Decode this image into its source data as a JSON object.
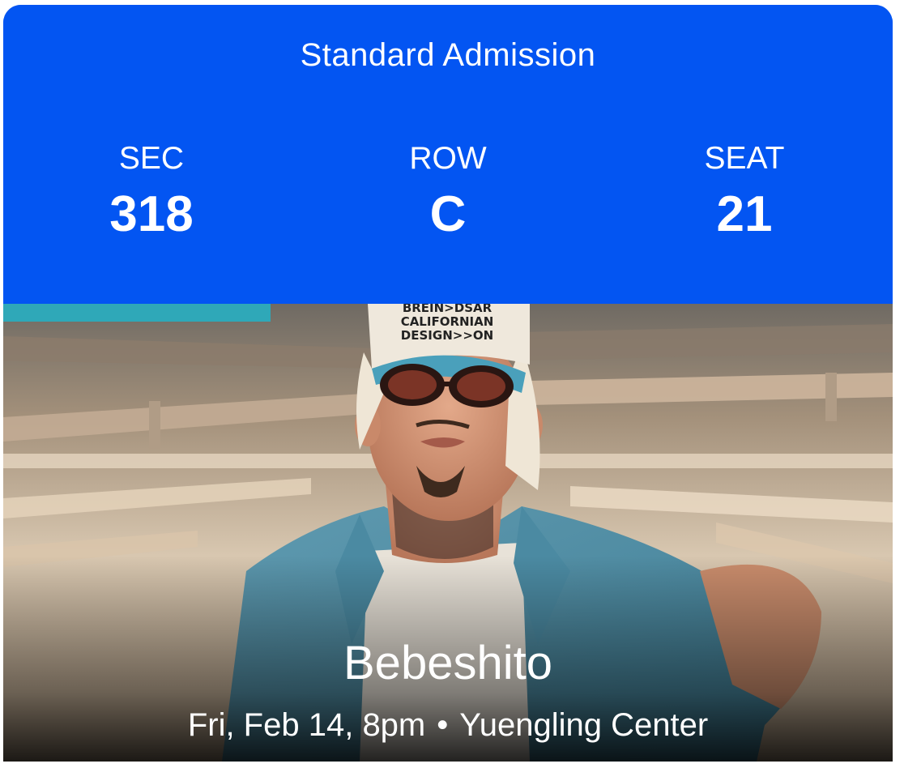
{
  "ticket": {
    "admission_type": "Standard Admission",
    "section": {
      "label": "SEC",
      "value": "318"
    },
    "row": {
      "label": "ROW",
      "value": "C"
    },
    "seat": {
      "label": "SEAT",
      "value": "21"
    }
  },
  "event": {
    "artist": "Bebeshito",
    "date_time": "Fri, Feb 14, 8pm",
    "separator": "•",
    "venue": "Yuengling Center",
    "cap_text": [
      "BREIN>DSAR",
      "CALIFORNIAN",
      "DESIGN>>ON"
    ]
  },
  "colors": {
    "header_blue": "#0355F2",
    "text_white": "#FFFFFF"
  }
}
